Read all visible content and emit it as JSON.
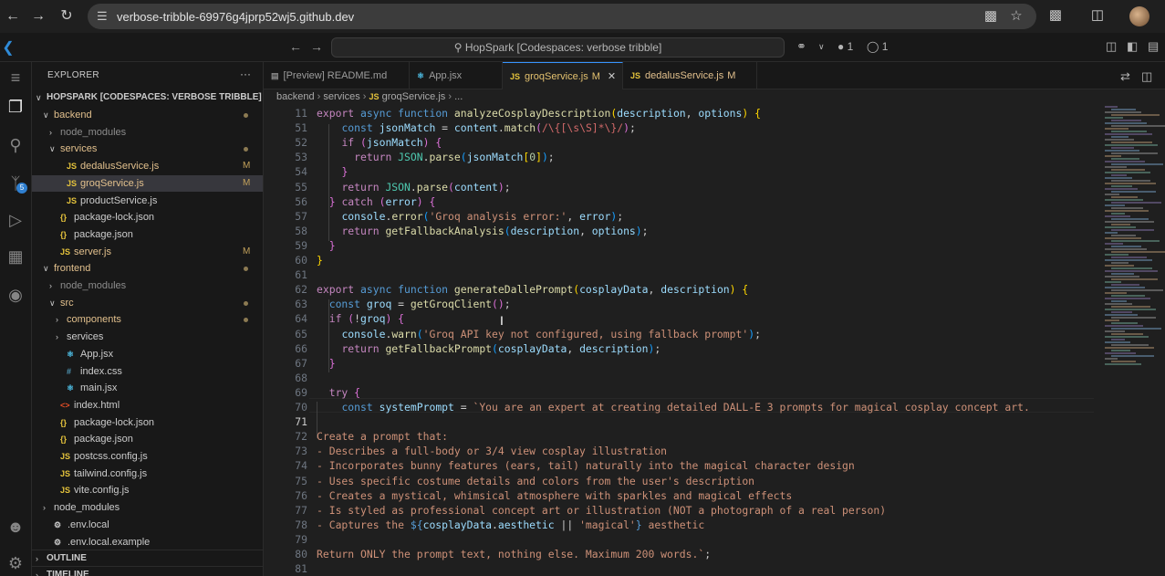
{
  "browser": {
    "url": "verbose-tribble-69976g4jprp52wj5.github.dev",
    "icons": [
      "back-arrow-icon",
      "forward-arrow-icon",
      "reload-icon",
      "site-info-icon",
      "install-app-icon",
      "bookmark-star-icon",
      "extensions-icon",
      "sidebar-toggle-icon",
      "profile-avatar"
    ]
  },
  "titlebar": {
    "search": "HopSpark [Codespaces: verbose tribble]",
    "ports_count": "1",
    "sync_count": "1"
  },
  "activity_bar": {
    "items": [
      "explorer-icon",
      "search-icon",
      "source-control-icon",
      "run-debug-icon",
      "extensions-icon",
      "github-icon"
    ],
    "scm_badge": "5",
    "bottom": [
      "account-icon",
      "manage-gear-icon"
    ]
  },
  "explorer": {
    "title": "EXPLORER",
    "more": "···",
    "root": "HOPSPARK [CODESPACES: VERBOSE TRIBBLE]",
    "items": [
      {
        "label": "backend",
        "kind": "folder",
        "open": true,
        "depth": 1,
        "status": "dot",
        "color": "#e2c08d"
      },
      {
        "label": "node_modules",
        "kind": "folder",
        "open": false,
        "depth": 2,
        "status": "",
        "color": "#8c8c8c"
      },
      {
        "label": "services",
        "kind": "folder",
        "open": true,
        "depth": 2,
        "status": "dot",
        "color": "#e2c08d"
      },
      {
        "label": "dedalusService.js",
        "kind": "js",
        "depth": 3,
        "status": "M",
        "color": "#e2c08d"
      },
      {
        "label": "groqService.js",
        "kind": "js",
        "depth": 3,
        "status": "M",
        "color": "#e2c08d",
        "selected": true
      },
      {
        "label": "productService.js",
        "kind": "js",
        "depth": 3,
        "status": "",
        "color": "#cccccc"
      },
      {
        "label": "package-lock.json",
        "kind": "json",
        "depth": 2,
        "status": "",
        "color": "#cccccc"
      },
      {
        "label": "package.json",
        "kind": "json",
        "depth": 2,
        "status": "",
        "color": "#cccccc"
      },
      {
        "label": "server.js",
        "kind": "js",
        "depth": 2,
        "status": "M",
        "color": "#e2c08d"
      },
      {
        "label": "frontend",
        "kind": "folder",
        "open": true,
        "depth": 1,
        "status": "dot",
        "color": "#e2c08d"
      },
      {
        "label": "node_modules",
        "kind": "folder",
        "open": false,
        "depth": 2,
        "status": "",
        "color": "#8c8c8c"
      },
      {
        "label": "src",
        "kind": "folder",
        "open": true,
        "depth": 2,
        "status": "dot",
        "color": "#e2c08d"
      },
      {
        "label": "components",
        "kind": "folder",
        "open": false,
        "depth": 3,
        "status": "dot",
        "color": "#e2c08d"
      },
      {
        "label": "services",
        "kind": "folder",
        "open": false,
        "depth": 3,
        "status": "",
        "color": "#cccccc"
      },
      {
        "label": "App.jsx",
        "kind": "jsx",
        "depth": 3,
        "status": "",
        "color": "#cccccc"
      },
      {
        "label": "index.css",
        "kind": "css",
        "depth": 3,
        "status": "",
        "color": "#cccccc"
      },
      {
        "label": "main.jsx",
        "kind": "jsx",
        "depth": 3,
        "status": "",
        "color": "#cccccc"
      },
      {
        "label": "index.html",
        "kind": "html",
        "depth": 2,
        "status": "",
        "color": "#cccccc"
      },
      {
        "label": "package-lock.json",
        "kind": "json",
        "depth": 2,
        "status": "",
        "color": "#cccccc"
      },
      {
        "label": "package.json",
        "kind": "json",
        "depth": 2,
        "status": "",
        "color": "#cccccc"
      },
      {
        "label": "postcss.config.js",
        "kind": "js",
        "depth": 2,
        "status": "",
        "color": "#cccccc"
      },
      {
        "label": "tailwind.config.js",
        "kind": "js",
        "depth": 2,
        "status": "",
        "color": "#cccccc"
      },
      {
        "label": "vite.config.js",
        "kind": "js",
        "depth": 2,
        "status": "",
        "color": "#cccccc"
      },
      {
        "label": "node_modules",
        "kind": "folder",
        "open": false,
        "depth": 1,
        "status": "",
        "color": "#cccccc"
      },
      {
        "label": ".env.local",
        "kind": "env",
        "depth": 1,
        "status": "",
        "color": "#cccccc"
      },
      {
        "label": ".env.local.example",
        "kind": "env",
        "depth": 1,
        "status": "",
        "color": "#cccccc"
      }
    ],
    "sections": [
      "OUTLINE",
      "TIMELINE"
    ]
  },
  "tabs": [
    {
      "label": "[Preview] README.md",
      "icon": "preview",
      "status": ""
    },
    {
      "label": "App.jsx",
      "icon": "react",
      "status": ""
    },
    {
      "label": "groqService.js",
      "icon": "js",
      "status": "M",
      "active": true
    },
    {
      "label": "dedalusService.js",
      "icon": "js",
      "status": "M"
    }
  ],
  "breadcrumb": {
    "parts": [
      "backend",
      "services",
      "groqService.js",
      "..."
    ]
  },
  "code": {
    "current_line": "71",
    "lines": [
      {
        "n": "11",
        "t": [
          [
            "k",
            "export"
          ],
          [
            "p",
            " "
          ],
          [
            "kb",
            "async"
          ],
          [
            "p",
            " "
          ],
          [
            "kb",
            "function"
          ],
          [
            "p",
            " "
          ],
          [
            "fn",
            "analyzeCosplayDescription"
          ],
          [
            "br",
            "("
          ],
          [
            "v",
            "description"
          ],
          [
            "p",
            ", "
          ],
          [
            "v",
            "options"
          ],
          [
            "br",
            ")"
          ],
          [
            "p",
            " "
          ],
          [
            "br",
            "{"
          ]
        ]
      },
      {
        "n": "51",
        "t": [
          [
            "p",
            "    "
          ],
          [
            "kb",
            "const"
          ],
          [
            "p",
            " "
          ],
          [
            "v",
            "jsonMatch"
          ],
          [
            "p",
            " = "
          ],
          [
            "v",
            "content"
          ],
          [
            "p",
            "."
          ],
          [
            "fn",
            "match"
          ],
          [
            "br2",
            "("
          ],
          [
            "rx",
            "/\\{[\\s\\S]*\\}/"
          ],
          [
            "br2",
            ")"
          ],
          [
            "p",
            ";"
          ]
        ]
      },
      {
        "n": "52",
        "t": [
          [
            "p",
            "    "
          ],
          [
            "k",
            "if"
          ],
          [
            "p",
            " "
          ],
          [
            "br2",
            "("
          ],
          [
            "v",
            "jsonMatch"
          ],
          [
            "br2",
            ")"
          ],
          [
            "p",
            " "
          ],
          [
            "br2",
            "{"
          ]
        ]
      },
      {
        "n": "53",
        "t": [
          [
            "p",
            "      "
          ],
          [
            "k",
            "return"
          ],
          [
            "p",
            " "
          ],
          [
            "c",
            "JSON"
          ],
          [
            "p",
            "."
          ],
          [
            "fn",
            "parse"
          ],
          [
            "br3",
            "("
          ],
          [
            "v",
            "jsonMatch"
          ],
          [
            "br",
            "["
          ],
          [
            "n",
            "0"
          ],
          [
            "br",
            "]"
          ],
          [
            "br3",
            ")"
          ],
          [
            "p",
            ";"
          ]
        ]
      },
      {
        "n": "54",
        "t": [
          [
            "p",
            "    "
          ],
          [
            "br2",
            "}"
          ]
        ]
      },
      {
        "n": "55",
        "t": [
          [
            "p",
            "    "
          ],
          [
            "k",
            "return"
          ],
          [
            "p",
            " "
          ],
          [
            "c",
            "JSON"
          ],
          [
            "p",
            "."
          ],
          [
            "fn",
            "parse"
          ],
          [
            "br2",
            "("
          ],
          [
            "v",
            "content"
          ],
          [
            "br2",
            ")"
          ],
          [
            "p",
            ";"
          ]
        ]
      },
      {
        "n": "56",
        "t": [
          [
            "p",
            "  "
          ],
          [
            "br2",
            "}"
          ],
          [
            "p",
            " "
          ],
          [
            "k",
            "catch"
          ],
          [
            "p",
            " "
          ],
          [
            "br2",
            "("
          ],
          [
            "v",
            "error"
          ],
          [
            "br2",
            ")"
          ],
          [
            "p",
            " "
          ],
          [
            "br2",
            "{"
          ]
        ]
      },
      {
        "n": "57",
        "t": [
          [
            "p",
            "    "
          ],
          [
            "v",
            "console"
          ],
          [
            "p",
            "."
          ],
          [
            "fn",
            "error"
          ],
          [
            "br3",
            "("
          ],
          [
            "s",
            "'Groq analysis error:'"
          ],
          [
            "p",
            ", "
          ],
          [
            "v",
            "error"
          ],
          [
            "br3",
            ")"
          ],
          [
            "p",
            ";"
          ]
        ]
      },
      {
        "n": "58",
        "t": [
          [
            "p",
            "    "
          ],
          [
            "k",
            "return"
          ],
          [
            "p",
            " "
          ],
          [
            "fn",
            "getFallbackAnalysis"
          ],
          [
            "br3",
            "("
          ],
          [
            "v",
            "description"
          ],
          [
            "p",
            ", "
          ],
          [
            "v",
            "options"
          ],
          [
            "br3",
            ")"
          ],
          [
            "p",
            ";"
          ]
        ]
      },
      {
        "n": "59",
        "t": [
          [
            "p",
            "  "
          ],
          [
            "br2",
            "}"
          ]
        ]
      },
      {
        "n": "60",
        "t": [
          [
            "br",
            "}"
          ]
        ]
      },
      {
        "n": "61",
        "t": []
      },
      {
        "n": "62",
        "t": [
          [
            "k",
            "export"
          ],
          [
            "p",
            " "
          ],
          [
            "kb",
            "async"
          ],
          [
            "p",
            " "
          ],
          [
            "kb",
            "function"
          ],
          [
            "p",
            " "
          ],
          [
            "fn",
            "generateDallePrompt"
          ],
          [
            "br",
            "("
          ],
          [
            "v",
            "cosplayData"
          ],
          [
            "p",
            ", "
          ],
          [
            "v",
            "description"
          ],
          [
            "br",
            ")"
          ],
          [
            "p",
            " "
          ],
          [
            "br",
            "{"
          ]
        ]
      },
      {
        "n": "63",
        "t": [
          [
            "p",
            "  "
          ],
          [
            "kb",
            "const"
          ],
          [
            "p",
            " "
          ],
          [
            "v",
            "groq"
          ],
          [
            "p",
            " = "
          ],
          [
            "fn",
            "getGroqClient"
          ],
          [
            "br2",
            "()"
          ],
          [
            "p",
            ";"
          ]
        ]
      },
      {
        "n": "64",
        "t": [
          [
            "p",
            "  "
          ],
          [
            "k",
            "if"
          ],
          [
            "p",
            " "
          ],
          [
            "br2",
            "("
          ],
          [
            "p",
            "!"
          ],
          [
            "v",
            "groq"
          ],
          [
            "br2",
            ")"
          ],
          [
            "p",
            " "
          ],
          [
            "br2",
            "{"
          ]
        ]
      },
      {
        "n": "65",
        "t": [
          [
            "p",
            "    "
          ],
          [
            "v",
            "console"
          ],
          [
            "p",
            "."
          ],
          [
            "fn",
            "warn"
          ],
          [
            "br3",
            "("
          ],
          [
            "s",
            "'Groq API key not configured, using fallback prompt'"
          ],
          [
            "br3",
            ")"
          ],
          [
            "p",
            ";"
          ]
        ]
      },
      {
        "n": "66",
        "t": [
          [
            "p",
            "    "
          ],
          [
            "k",
            "return"
          ],
          [
            "p",
            " "
          ],
          [
            "fn",
            "getFallbackPrompt"
          ],
          [
            "br3",
            "("
          ],
          [
            "v",
            "cosplayData"
          ],
          [
            "p",
            ", "
          ],
          [
            "v",
            "description"
          ],
          [
            "br3",
            ")"
          ],
          [
            "p",
            ";"
          ]
        ]
      },
      {
        "n": "67",
        "t": [
          [
            "p",
            "  "
          ],
          [
            "br2",
            "}"
          ]
        ]
      },
      {
        "n": "68",
        "t": []
      },
      {
        "n": "69",
        "t": [
          [
            "p",
            "  "
          ],
          [
            "k",
            "try"
          ],
          [
            "p",
            " "
          ],
          [
            "br2",
            "{"
          ]
        ]
      },
      {
        "n": "70",
        "t": [
          [
            "p",
            "    "
          ],
          [
            "kb",
            "const"
          ],
          [
            "p",
            " "
          ],
          [
            "v",
            "systemPrompt"
          ],
          [
            "p",
            " = "
          ],
          [
            "s",
            "`You are an expert at creating detailed DALL-E 3 prompts for magical cosplay concept art."
          ]
        ]
      },
      {
        "n": "71",
        "t": []
      },
      {
        "n": "72",
        "t": [
          [
            "s",
            "Create a prompt that:"
          ]
        ]
      },
      {
        "n": "73",
        "t": [
          [
            "s",
            "- Describes a full-body or 3/4 view cosplay illustration"
          ]
        ]
      },
      {
        "n": "74",
        "t": [
          [
            "s",
            "- Incorporates bunny features (ears, tail) naturally into the magical character design"
          ]
        ]
      },
      {
        "n": "75",
        "t": [
          [
            "s",
            "- Uses specific costume details and colors from the user's description"
          ]
        ]
      },
      {
        "n": "76",
        "t": [
          [
            "s",
            "- Creates a mystical, whimsical atmosphere with sparkles and magical effects"
          ]
        ]
      },
      {
        "n": "77",
        "t": [
          [
            "s",
            "- Is styled as professional concept art or illustration (NOT a photograph of a real person)"
          ]
        ]
      },
      {
        "n": "78",
        "t": [
          [
            "s",
            "- Captures the "
          ],
          [
            "kb",
            "${"
          ],
          [
            "v",
            "cosplayData"
          ],
          [
            "p",
            "."
          ],
          [
            "v",
            "aesthetic"
          ],
          [
            "p",
            " || "
          ],
          [
            "s",
            "'magical'"
          ],
          [
            "kb",
            "}"
          ],
          [
            "s",
            " aesthetic"
          ]
        ]
      },
      {
        "n": "79",
        "t": []
      },
      {
        "n": "80",
        "t": [
          [
            "s",
            "Return ONLY the prompt text, nothing else. Maximum 200 words.`"
          ],
          [
            "p",
            ";"
          ]
        ]
      },
      {
        "n": "81",
        "t": []
      }
    ]
  }
}
